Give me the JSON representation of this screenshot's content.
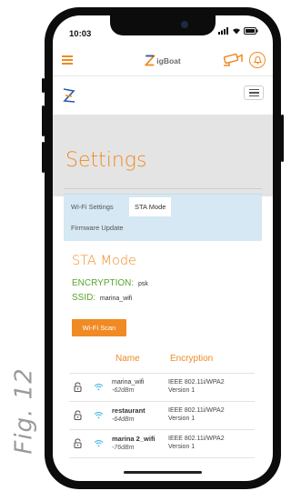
{
  "figure_label": "Fig. 12",
  "status_bar": {
    "time": "10:03"
  },
  "header": {
    "brand": "igBoat"
  },
  "page": {
    "title": "Settings"
  },
  "tabs": [
    "Wi-Fi Settings",
    "STA Mode",
    "Firmware Update"
  ],
  "active_tab": "STA Mode",
  "sta": {
    "title": "STA Mode",
    "encryption_label": "ENCRYPTION:",
    "encryption_value": "psk",
    "ssid_label": "SSID:",
    "ssid_value": "marina_wifi",
    "scan_button": "Wi-Fi Scan"
  },
  "table": {
    "columns": [
      "Name",
      "Encryption"
    ],
    "rows": [
      {
        "name": "marina_wifi",
        "signal": "-62dBm",
        "encryption": "IEEE 802.11i/WPA2",
        "version": "Version 1",
        "bold": false
      },
      {
        "name": "restaurant",
        "signal": "-64dBm",
        "encryption": "IEEE 802.11i/WPA2",
        "version": "Version 1",
        "bold": true
      },
      {
        "name": "marina 2_wifi",
        "signal": "-76dBm",
        "encryption": "IEEE 802.11i/WPA2",
        "version": "Version 1",
        "bold": true
      }
    ]
  },
  "colors": {
    "accent": "#f08a24",
    "green": "#5aa52b",
    "wifi": "#3fb3e6",
    "tab_panel": "#d5e8f3"
  },
  "icons": [
    "hamburger-icon",
    "camera-icon",
    "bell-icon",
    "zigboat-logo",
    "menu-toggle-icon",
    "lock-icon",
    "wifi-icon"
  ]
}
